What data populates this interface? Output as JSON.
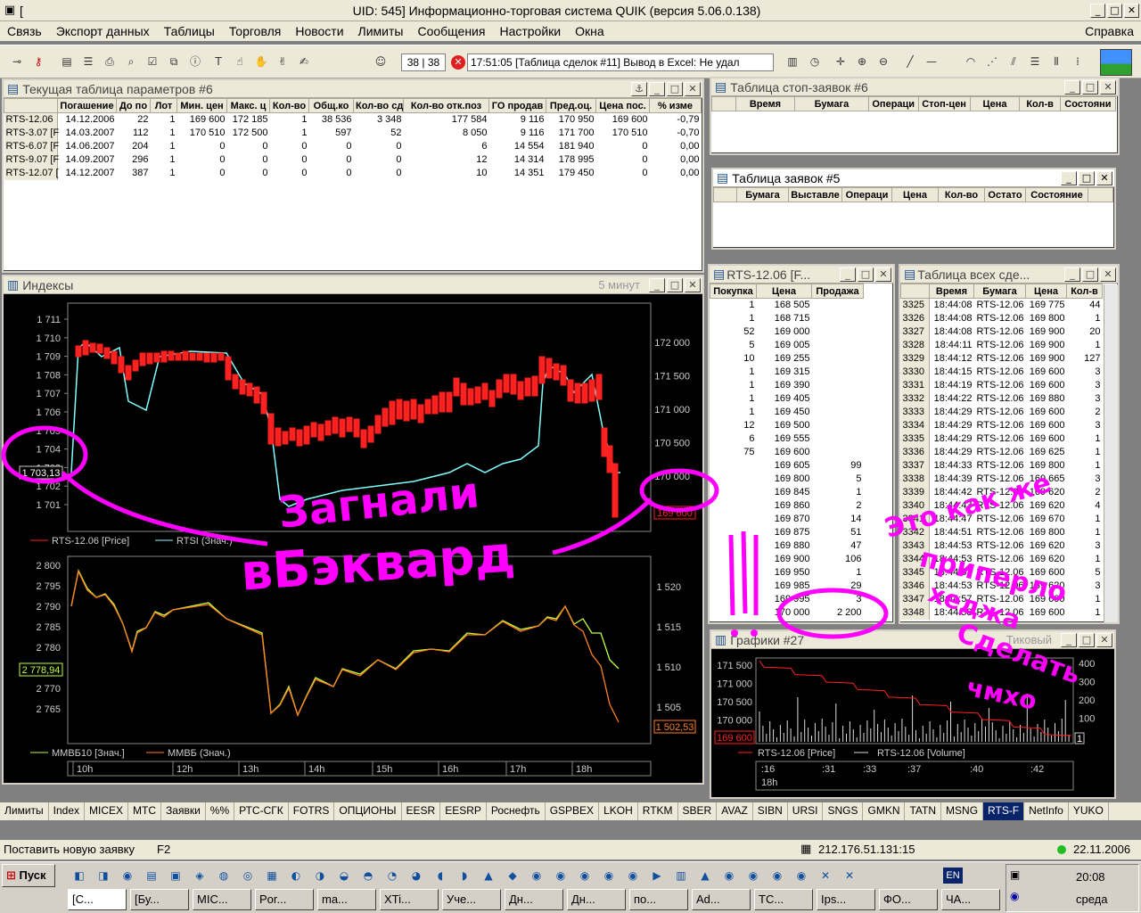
{
  "app": {
    "title": "UID: 545] Информационно-торговая система QUIK (версия 5.06.0.138)",
    "title_prefix": "["
  },
  "menu": [
    "Связь",
    "Экспорт данных",
    "Таблицы",
    "Торговля",
    "Новости",
    "Лимиты",
    "Сообщения",
    "Настройки",
    "Окна"
  ],
  "menu_right": "Справка",
  "toolbar": {
    "counter": "38 | 38",
    "message": "17:51:05  [Таблица сделок #11] Вывод в Excel: Не удал"
  },
  "params": {
    "title": "Текущая таблица параметров #6",
    "headers": [
      "Погашение",
      "До по",
      "Лот",
      "Мин. цен",
      "Макс. ц",
      "Кол-во",
      "Общ.ко",
      "Кол-во сд",
      "Кол-во отк.поз",
      "ГО продав",
      "Пред.оц.",
      "Цена пос.",
      "% изме"
    ],
    "rows": [
      [
        "RTS-12.06",
        "14.12.2006",
        "22",
        "1",
        "169 600",
        "172 185",
        "1",
        "38 536",
        "3 348",
        "177 584",
        "9 116",
        "170 950",
        "169 600",
        "-0,79"
      ],
      [
        "RTS-3.07 [F",
        "14.03.2007",
        "112",
        "1",
        "170 510",
        "172 500",
        "1",
        "597",
        "52",
        "8 050",
        "9 116",
        "171 700",
        "170 510",
        "-0,70"
      ],
      [
        "RTS-6.07 [F",
        "14.06.2007",
        "204",
        "1",
        "0",
        "0",
        "0",
        "0",
        "0",
        "6",
        "14 554",
        "181 940",
        "0",
        "0,00"
      ],
      [
        "RTS-9.07 [F",
        "14.09.2007",
        "296",
        "1",
        "0",
        "0",
        "0",
        "0",
        "0",
        "12",
        "14 314",
        "178 995",
        "0",
        "0,00"
      ],
      [
        "RTS-12.07 [",
        "14.12.2007",
        "387",
        "1",
        "0",
        "0",
        "0",
        "0",
        "0",
        "10",
        "14 351",
        "179 450",
        "0",
        "0,00"
      ]
    ]
  },
  "stops": {
    "title": "Таблица стоп-заявок #6",
    "headers": [
      "Время",
      "Бумага",
      "Операци",
      "Стоп-цен",
      "Цена",
      "Кол-в",
      "Состояни"
    ]
  },
  "orders": {
    "title": "Таблица заявок #5",
    "headers": [
      "Бумага",
      "Выставле",
      "Операци",
      "Цена",
      "Кол-во",
      "Остато",
      "Состояние"
    ]
  },
  "depth": {
    "title": "RTS-12.06 [F...",
    "headers": [
      "Покупка",
      "Цена",
      "Продажа"
    ],
    "rows": [
      [
        "1",
        "168 505",
        ""
      ],
      [
        "1",
        "168 715",
        ""
      ],
      [
        "52",
        "169 000",
        ""
      ],
      [
        "5",
        "169 005",
        ""
      ],
      [
        "10",
        "169 255",
        ""
      ],
      [
        "1",
        "169 315",
        ""
      ],
      [
        "1",
        "169 390",
        ""
      ],
      [
        "1",
        "169 405",
        ""
      ],
      [
        "1",
        "169 450",
        ""
      ],
      [
        "12",
        "169 500",
        ""
      ],
      [
        "6",
        "169 555",
        ""
      ],
      [
        "75",
        "169 600",
        ""
      ],
      [
        "",
        "169 605",
        "99"
      ],
      [
        "",
        "169 800",
        "5"
      ],
      [
        "",
        "169 845",
        "1"
      ],
      [
        "",
        "169 860",
        "2"
      ],
      [
        "",
        "169 870",
        "14"
      ],
      [
        "",
        "169 875",
        "51"
      ],
      [
        "",
        "169 880",
        "47"
      ],
      [
        "",
        "169 900",
        "106"
      ],
      [
        "",
        "169 950",
        "1"
      ],
      [
        "",
        "169 985",
        "29"
      ],
      [
        "",
        "169 995",
        "3"
      ],
      [
        "",
        "170 000",
        "2 200"
      ]
    ]
  },
  "trades": {
    "title": "Таблица всех сде...",
    "headers": [
      "",
      "Время",
      "Бумага",
      "Цена",
      "Кол-в"
    ],
    "rows": [
      [
        "3325",
        "18:44:08",
        "RTS-12.06",
        "169 775",
        "44"
      ],
      [
        "3326",
        "18:44:08",
        "RTS-12.06",
        "169 800",
        "1"
      ],
      [
        "3327",
        "18:44:08",
        "RTS-12.06",
        "169 900",
        "20"
      ],
      [
        "3328",
        "18:44:11",
        "RTS-12.06",
        "169 900",
        "1"
      ],
      [
        "3329",
        "18:44:12",
        "RTS-12.06",
        "169 900",
        "127"
      ],
      [
        "3330",
        "18:44:15",
        "RTS-12.06",
        "169 600",
        "3"
      ],
      [
        "3331",
        "18:44:19",
        "RTS-12.06",
        "169 600",
        "3"
      ],
      [
        "3332",
        "18:44:22",
        "RTS-12.06",
        "169 880",
        "3"
      ],
      [
        "3333",
        "18:44:29",
        "RTS-12.06",
        "169 600",
        "2"
      ],
      [
        "3334",
        "18:44:29",
        "RTS-12.06",
        "169 600",
        "3"
      ],
      [
        "3335",
        "18:44:29",
        "RTS-12.06",
        "169 600",
        "1"
      ],
      [
        "3336",
        "18:44:29",
        "RTS-12.06",
        "169 625",
        "1"
      ],
      [
        "3337",
        "18:44:33",
        "RTS-12.06",
        "169 800",
        "1"
      ],
      [
        "3338",
        "18:44:39",
        "RTS-12.06",
        "169 665",
        "3"
      ],
      [
        "3339",
        "18:44:42",
        "RTS-12.06",
        "169 620",
        "2"
      ],
      [
        "3340",
        "18:44:43",
        "RTS-12.06",
        "169 620",
        "4"
      ],
      [
        "3341",
        "18:44:47",
        "RTS-12.06",
        "169 670",
        "1"
      ],
      [
        "3342",
        "18:44:51",
        "RTS-12.06",
        "169 800",
        "1"
      ],
      [
        "3343",
        "18:44:53",
        "RTS-12.06",
        "169 620",
        "3"
      ],
      [
        "3344",
        "18:44:53",
        "RTS-12.06",
        "169 620",
        "1"
      ],
      [
        "3345",
        "18:44:53",
        "RTS-12.06",
        "169 600",
        "5"
      ],
      [
        "3346",
        "18:44:53",
        "RTS-12.06",
        "169 620",
        "3"
      ],
      [
        "3347",
        "18:44:57",
        "RTS-12.06",
        "169 600",
        "1"
      ],
      [
        "3348",
        "18:44:58",
        "RTS-12.06",
        "169 600",
        "1"
      ]
    ]
  },
  "indices": {
    "title": "Индексы",
    "period": "5 минут",
    "top_left_ticks": [
      "1 711",
      "1 710",
      "1 709",
      "1 708",
      "1 707",
      "1 706",
      "1 705",
      "1 704",
      "1 703",
      "1 702",
      "1 701"
    ],
    "top_right_ticks": [
      "172 000",
      "171 500",
      "171 000",
      "170 500",
      "170 000"
    ],
    "top_left_marker": "1 703,13",
    "top_right_marker": "169 600",
    "top_legend": [
      "RTS-12.06 [Price]",
      "RTSI (Знач.)"
    ],
    "bot_left_ticks": [
      "2 800",
      "2 795",
      "2 790",
      "2 785",
      "2 780",
      "2 775",
      "2 770",
      "2 765"
    ],
    "bot_right_ticks": [
      "1 520",
      "1 515",
      "1 510",
      "1 505"
    ],
    "bot_left_marker": "2 778,94",
    "bot_right_marker": "1 502,53",
    "bot_legend": [
      "ММВБ10 [Знач.]",
      "ММВБ (Знач.)"
    ],
    "x_ticks": [
      "10h",
      "12h",
      "13h",
      "14h",
      "15h",
      "16h",
      "17h",
      "18h"
    ]
  },
  "small_chart": {
    "title": "Графики #27",
    "mode": "Тиковый",
    "left_ticks": [
      "171 500",
      "171 000",
      "170 500",
      "170 000"
    ],
    "right_ticks": [
      "400",
      "300",
      "200",
      "100",
      "0"
    ],
    "marker": "169 600",
    "marker_right": "1",
    "legend": [
      "RTS-12.06 [Price]",
      "RTS-12.06 [Volume]"
    ],
    "x_ticks": [
      ":16",
      ":31",
      ":33",
      ":37",
      ":40",
      ":42"
    ],
    "x_label": "18h"
  },
  "colors": {
    "price": "#ff2020",
    "index": "#80ffff",
    "mmvb10": "#c0ff40",
    "mmvb": "#ff8020",
    "annotation": "#ff00ff"
  },
  "tabs": [
    "Лимиты",
    "Index",
    "MICEX",
    "MTC",
    "Заявки",
    "%%",
    "РТС-СГК",
    "FOTRS",
    "ОПЦИОНЫ",
    "EESR",
    "EESRP",
    "Роснефть",
    "GSPBEX",
    "LKOH",
    "RTKM",
    "SBER",
    "AVAZ",
    "SIBN",
    "URSI",
    "SNGS",
    "GMKN",
    "TATN",
    "MSNG",
    "RTS-F",
    "NetInfo",
    "YUKO"
  ],
  "active_tab": "RTS-F",
  "status": {
    "hint": "Поставить новую заявку",
    "key": "F2",
    "ip": "212.176.51.131:15",
    "date": "22.11.2006"
  },
  "taskbar": {
    "start": "Пуск",
    "lang": "EN",
    "time": "20:08",
    "day": "среда",
    "tasks": [
      "[С...",
      "[Бу...",
      "MIC...",
      "Por...",
      "ma...",
      "XTi...",
      "Уче...",
      "Дн...",
      "Дн...",
      "по...",
      "Ad...",
      "TC...",
      "Ips...",
      "ФО...",
      "ЧА..."
    ]
  },
  "annotations": {
    "left": "Загнали",
    "left2": "вБэквард",
    "right": "Это как же",
    "right2": "приперло",
    "right3": "хеджа",
    "right4": "Сделать",
    "right5": "чмхо"
  }
}
